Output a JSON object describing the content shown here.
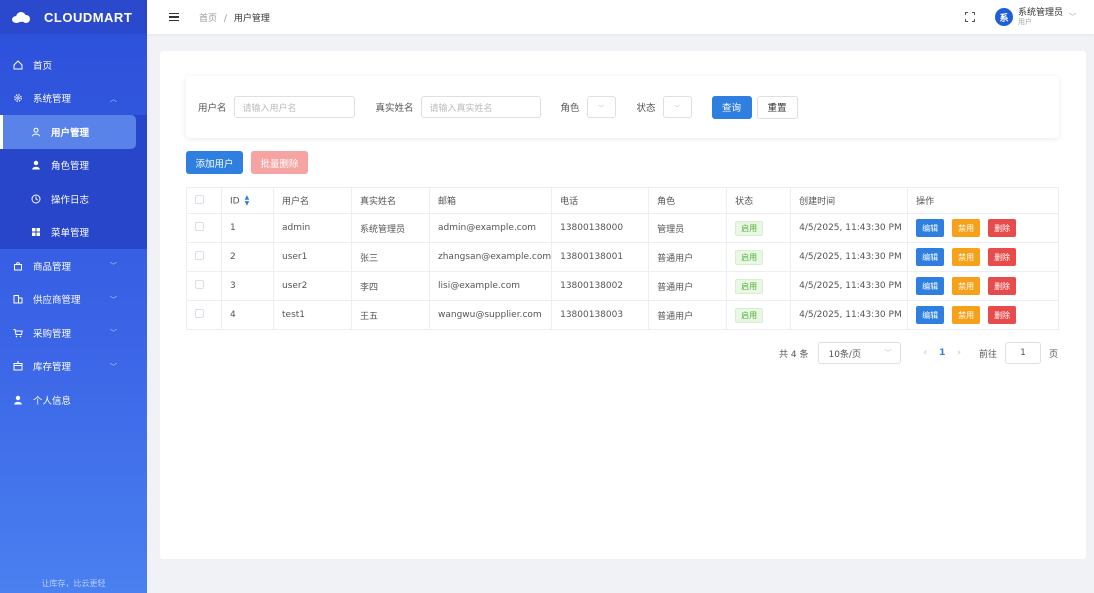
{
  "app": {
    "name": "CLOUDMART",
    "slogan": "让库存，比云更轻"
  },
  "sidebar": {
    "items": [
      {
        "label": "首页"
      },
      {
        "label": "系统管理"
      },
      {
        "label": "商品管理"
      },
      {
        "label": "供应商管理"
      },
      {
        "label": "采购管理"
      },
      {
        "label": "库存管理"
      },
      {
        "label": "个人信息"
      }
    ],
    "submenu": [
      {
        "label": "用户管理"
      },
      {
        "label": "角色管理"
      },
      {
        "label": "操作日志"
      },
      {
        "label": "菜单管理"
      }
    ]
  },
  "header": {
    "breadcrumb_home": "首页",
    "breadcrumb_sep": "/",
    "breadcrumb_current": "用户管理",
    "user_avatar": "系",
    "user_name": "系统管理员",
    "user_role": "用户"
  },
  "search": {
    "username_label": "用户名",
    "username_placeholder": "请输入用户名",
    "realname_label": "真实姓名",
    "realname_placeholder": "请输入真实姓名",
    "role_label": "角色",
    "status_label": "状态",
    "query_button": "查询",
    "reset_button": "重置"
  },
  "toolbar": {
    "add_button": "添加用户",
    "batch_delete_button": "批量删除"
  },
  "table": {
    "headers": [
      "ID",
      "用户名",
      "真实姓名",
      "邮箱",
      "电话",
      "角色",
      "状态",
      "创建时间",
      "操作"
    ],
    "rows": [
      {
        "id": "1",
        "username": "admin",
        "realname": "系统管理员",
        "email": "admin@example.com",
        "phone": "13800138000",
        "role": "管理员",
        "status": "启用",
        "created": "4/5/2025, 11:43:30 PM"
      },
      {
        "id": "2",
        "username": "user1",
        "realname": "张三",
        "email": "zhangsan@example.com",
        "phone": "13800138001",
        "role": "普通用户",
        "status": "启用",
        "created": "4/5/2025, 11:43:30 PM"
      },
      {
        "id": "3",
        "username": "user2",
        "realname": "李四",
        "email": "lisi@example.com",
        "phone": "13800138002",
        "role": "普通用户",
        "status": "启用",
        "created": "4/5/2025, 11:43:30 PM"
      },
      {
        "id": "4",
        "username": "test1",
        "realname": "王五",
        "email": "wangwu@supplier.com",
        "phone": "13800138003",
        "role": "普通用户",
        "status": "启用",
        "created": "4/5/2025, 11:43:30 PM"
      }
    ],
    "row_actions": {
      "edit": "编辑",
      "disable": "禁用",
      "delete": "删除"
    }
  },
  "pagination": {
    "total_text": "共 4 条",
    "page_size": "10条/页",
    "current_page": "1",
    "goto_label": "前往",
    "goto_value": "1",
    "page_suffix": "页"
  },
  "colors": {
    "primary": "#2e7fe0",
    "sidebar": "#2c4fd9",
    "warning": "#f6a11a",
    "danger": "#e84b4b",
    "success": "#52b035"
  }
}
